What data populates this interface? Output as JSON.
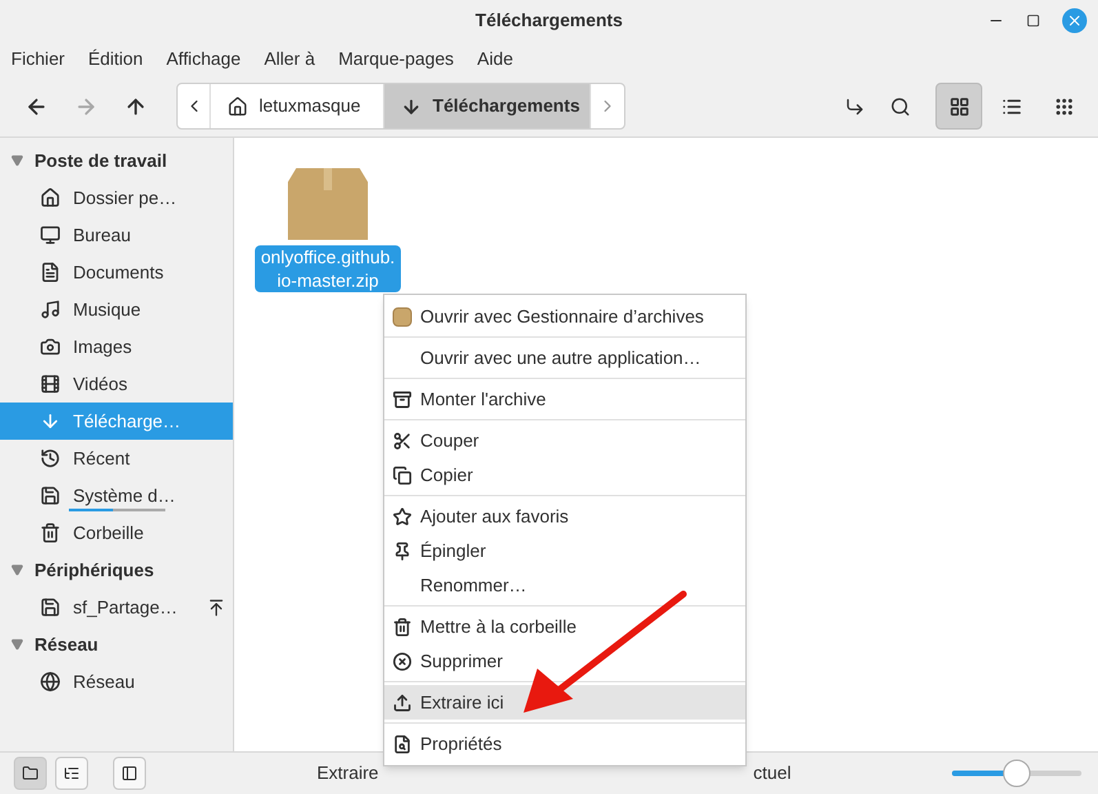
{
  "window": {
    "title": "Téléchargements"
  },
  "menubar": [
    "Fichier",
    "Édition",
    "Affichage",
    "Aller à",
    "Marque-pages",
    "Aide"
  ],
  "toolbar": {
    "back": {
      "disabled": false
    },
    "forward": {
      "disabled": true
    },
    "up": {
      "disabled": false
    },
    "breadcrumb": [
      {
        "label": "letuxmasque",
        "selected": false
      },
      {
        "label": "Téléchargements",
        "selected": true
      }
    ],
    "views": [
      {
        "selected": true
      },
      {
        "selected": false
      },
      {
        "selected": false
      }
    ]
  },
  "sidebar": [
    {
      "title": "Poste de travail",
      "expanded": true,
      "items": [
        {
          "label": "Dossier pe…",
          "selected": false
        },
        {
          "label": "Bureau",
          "selected": false
        },
        {
          "label": "Documents",
          "selected": false
        },
        {
          "label": "Musique",
          "selected": false
        },
        {
          "label": "Images",
          "selected": false
        },
        {
          "label": "Vidéos",
          "selected": false
        },
        {
          "label": "Télécharge…",
          "selected": true
        },
        {
          "label": "Récent",
          "selected": false
        },
        {
          "label": "Système d…",
          "selected": false,
          "level": 0.45
        },
        {
          "label": "Corbeille",
          "selected": false
        }
      ]
    },
    {
      "title": "Périphériques",
      "expanded": true,
      "items": [
        {
          "label": "sf_Partage…",
          "selected": false,
          "eject": true
        }
      ]
    },
    {
      "title": "Réseau",
      "expanded": true,
      "items": [
        {
          "label": "Réseau",
          "selected": false
        }
      ]
    }
  ],
  "files": [
    {
      "name": "onlyoffice.github.\nio-master.zip",
      "selected": true
    }
  ],
  "context_menu": [
    [
      {
        "label": "Ouvrir avec Gestionnaire d’archives",
        "selected": false
      }
    ],
    [
      {
        "label": "Ouvrir avec une autre application…",
        "selected": false
      }
    ],
    [
      {
        "label": "Monter l'archive",
        "selected": false
      }
    ],
    [
      {
        "label": "Couper",
        "selected": false
      },
      {
        "label": "Copier",
        "selected": false
      }
    ],
    [
      {
        "label": "Ajouter aux favoris",
        "selected": false
      },
      {
        "label": "Épingler",
        "selected": false
      },
      {
        "label": "Renommer…",
        "selected": false
      }
    ],
    [
      {
        "label": "Mettre à la corbeille",
        "selected": false
      },
      {
        "label": "Supprimer",
        "selected": false
      }
    ],
    [
      {
        "label": "Extraire ici",
        "selected": true
      }
    ],
    [
      {
        "label": "Propriétés",
        "selected": false
      }
    ]
  ],
  "status_bar": {
    "text_left": "Extraire",
    "text_right": "ctuel",
    "zoom": {
      "level": 0.5
    },
    "buttons": [
      {
        "selected": true
      },
      {
        "selected": false
      },
      {
        "selected": false
      }
    ]
  }
}
